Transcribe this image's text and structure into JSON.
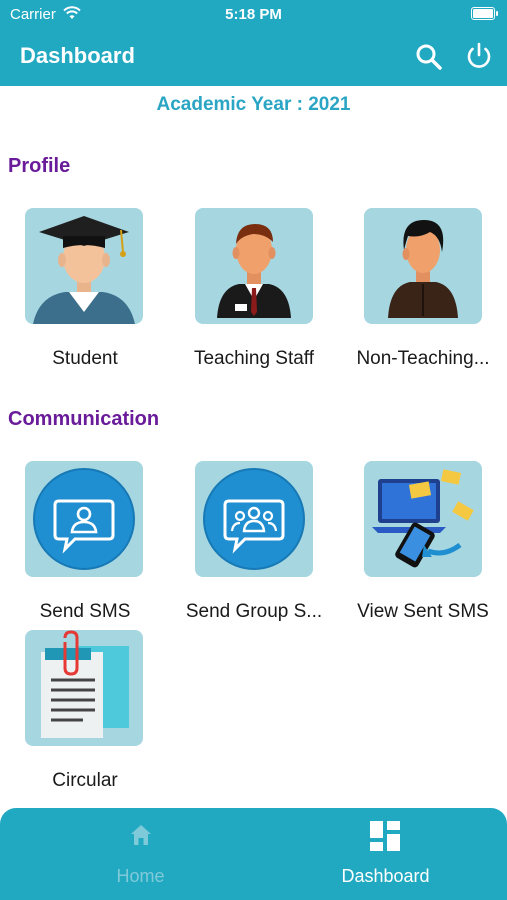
{
  "status": {
    "carrier": "Carrier",
    "time": "5:18 PM"
  },
  "header": {
    "title": "Dashboard"
  },
  "academic_year": "Academic Year : 2021",
  "sections": {
    "profile": {
      "title": "Profile",
      "items": [
        {
          "label": "Student",
          "icon": "student-graduate-icon"
        },
        {
          "label": "Teaching Staff",
          "icon": "teacher-icon"
        },
        {
          "label": "Non-Teaching...",
          "icon": "staff-person-icon"
        }
      ]
    },
    "communication": {
      "title": "Communication",
      "items": [
        {
          "label": "Send SMS",
          "icon": "sms-user-icon"
        },
        {
          "label": "Send Group S...",
          "icon": "sms-group-icon"
        },
        {
          "label": "View Sent SMS",
          "icon": "sent-messages-icon"
        },
        {
          "label": "Circular",
          "icon": "circular-document-icon"
        }
      ]
    }
  },
  "tabs": [
    {
      "label": "Home",
      "icon": "home-icon"
    },
    {
      "label": "Dashboard",
      "icon": "dashboard-icon"
    }
  ],
  "colors": {
    "primary": "#22a9c2",
    "section": "#6a1b9a",
    "tile": "#a6d6e0"
  }
}
